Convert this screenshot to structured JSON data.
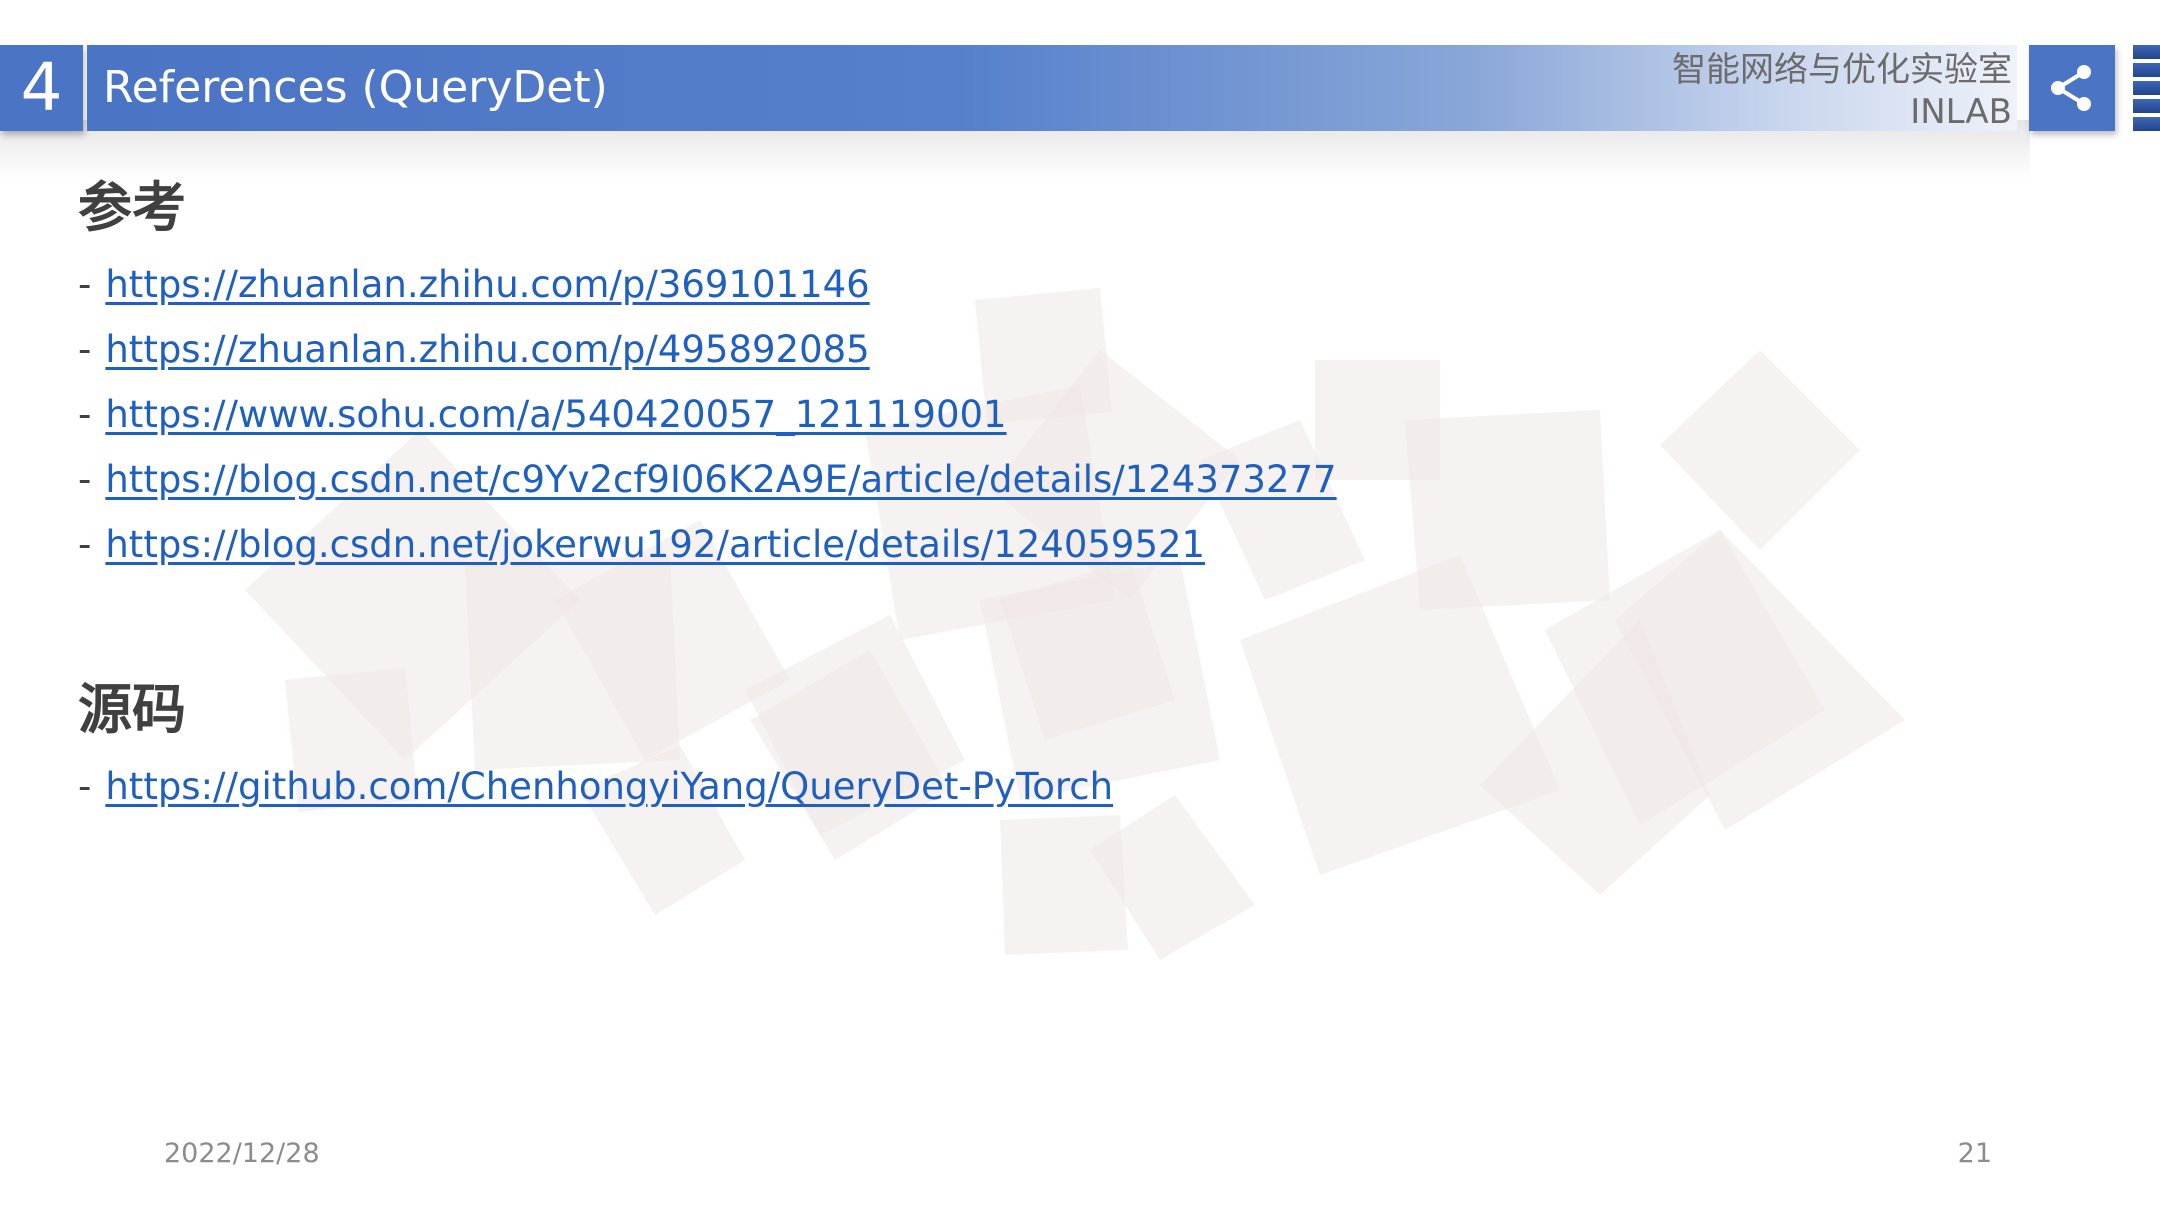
{
  "header": {
    "section_number": "4",
    "title": "References (QueryDet)",
    "lab_name": "智能网络与优化实验室",
    "lab_abbr": "INLAB",
    "share_icon": "share-icon"
  },
  "sections": {
    "references": {
      "heading": "参考",
      "dash": "-",
      "links": [
        "https://zhuanlan.zhihu.com/p/369101146",
        "https://zhuanlan.zhihu.com/p/495892085",
        "https://www.sohu.com/a/540420057_121119001",
        "https://blog.csdn.net/c9Yv2cf9I06K2A9E/article/details/124373277",
        "https://blog.csdn.net/jokerwu192/article/details/124059521"
      ]
    },
    "source": {
      "heading": "源码",
      "dash": "-",
      "links": [
        "https://github.com/ChenhongyiYang/QueryDet-PyTorch"
      ]
    }
  },
  "footer": {
    "date": "2022/12/28",
    "page": "21"
  },
  "colors": {
    "header_blue": "#4a74c4",
    "link": "#1f5fbf",
    "text": "#404040",
    "decor": "#f3efee"
  }
}
